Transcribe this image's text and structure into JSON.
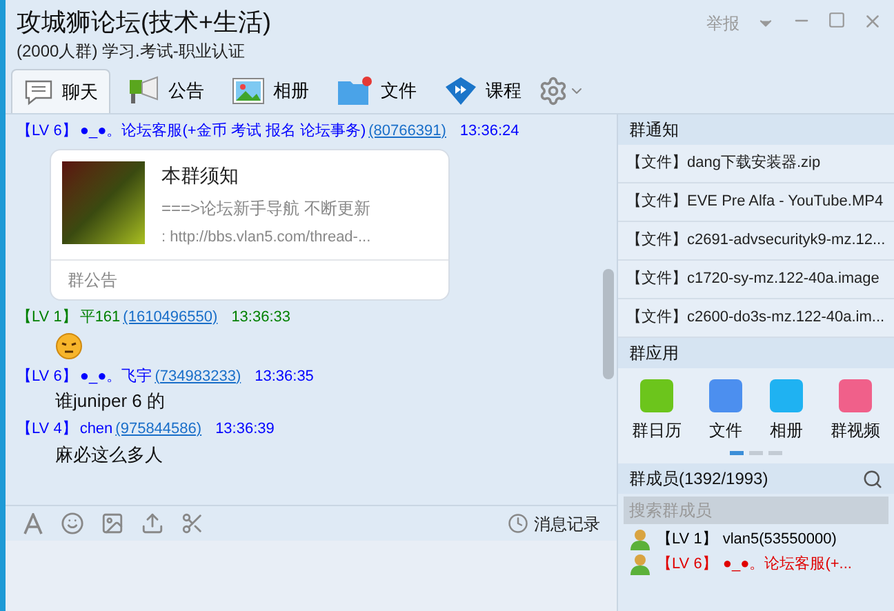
{
  "window": {
    "title": "攻城狮论坛(技术+生活)",
    "subtitle": "(2000人群) 学习.考试-职业认证",
    "report": "举报"
  },
  "tabs": [
    {
      "label": "聊天",
      "selected": true
    },
    {
      "label": "公告",
      "selected": false
    },
    {
      "label": "相册",
      "selected": false
    },
    {
      "label": "文件",
      "selected": false
    },
    {
      "label": "课程",
      "selected": false
    }
  ],
  "messages": [
    {
      "kind": "card",
      "level": "【LV 6】",
      "name": "●_●。论坛客服(+金币 考试 报名 论坛事务)",
      "qq": "(80766391)",
      "time": "13:36:24",
      "color": "#0000ff",
      "card": {
        "title": "本群须知",
        "line1": "===>论坛新手导航 不断更新",
        "line2": ":   http://bbs.vlan5.com/thread-...",
        "footer": "群公告"
      }
    },
    {
      "kind": "emoji",
      "level": "【LV 1】",
      "name": "平161",
      "qq": "(1610496550)",
      "time": "13:36:33",
      "color": "#008000"
    },
    {
      "kind": "text",
      "level": "【LV 6】",
      "name": "●_●。飞宇",
      "qq": "(734983233)",
      "time": "13:36:35",
      "color": "#0000ff",
      "text": "谁juniper 6 的"
    },
    {
      "kind": "text",
      "level": "【LV 4】",
      "name": "chen",
      "qq": "(975844586)",
      "time": "13:36:39",
      "color": "#0000ff",
      "text": "麻必这么多人"
    }
  ],
  "input_toolbar": {
    "history": "消息记录"
  },
  "notices": {
    "title": "群通知",
    "items": [
      "【文件】dang下载安装器.zip",
      "【文件】EVE Pre Alfa - YouTube.MP4",
      "【文件】c2691-advsecurityk9-mz.12...",
      "【文件】c1720-sy-mz.122-40a.image",
      "【文件】c2600-do3s-mz.122-40a.im..."
    ]
  },
  "apps": {
    "title": "群应用",
    "items": [
      {
        "label": "群日历",
        "color": "#6cc51c"
      },
      {
        "label": "文件",
        "color": "#4c8fef"
      },
      {
        "label": "相册",
        "color": "#1fb2f2"
      },
      {
        "label": "群视频",
        "color": "#f0608a"
      }
    ],
    "pages": [
      {
        "selected": true
      },
      {
        "selected": false
      },
      {
        "selected": false
      }
    ]
  },
  "members": {
    "title": "群成员(1392/1993)",
    "placeholder": "搜索群成员",
    "items": [
      {
        "level": "【LV 1】",
        "name": "vlan5(53550000)",
        "color": "#000000"
      },
      {
        "level": "【LV 6】",
        "name": "●_●。论坛客服(+...",
        "color": "#e00000"
      }
    ]
  }
}
